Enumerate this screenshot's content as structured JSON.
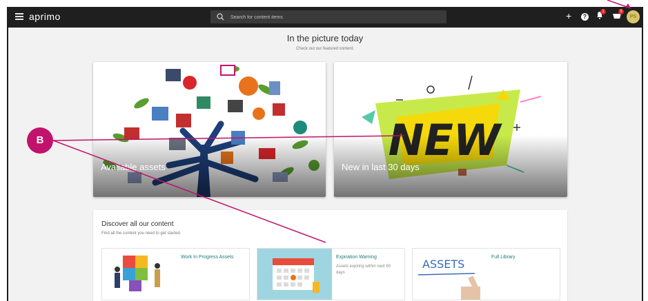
{
  "app": {
    "logo_text": "aprimo"
  },
  "search": {
    "placeholder": "Search for content items"
  },
  "toolbar": {
    "notifications_count": "1",
    "cart_count": "5",
    "user_initials": "PS"
  },
  "hero": {
    "title": "In the picture today",
    "subtitle": "Check out our featured content."
  },
  "featured": [
    {
      "label": "Available assets"
    },
    {
      "label": "New in last 30 days",
      "image_text": "NEW"
    }
  ],
  "discover": {
    "title": "Discover all our content",
    "subtitle": "Find all the content you need to get started.",
    "tiles": [
      {
        "title": "Work In Progress Assets",
        "description": ""
      },
      {
        "title": "Expiration Warning",
        "description": "Assets expiring within next 60 days"
      },
      {
        "title": "Full Library",
        "description": "",
        "image_text": "ASSETS"
      }
    ]
  },
  "callout": {
    "label": "B"
  },
  "colors": {
    "topbar": "#1f1f1f",
    "accent": "#1f7a78",
    "callout": "#c2136c",
    "badge": "#e02020"
  }
}
